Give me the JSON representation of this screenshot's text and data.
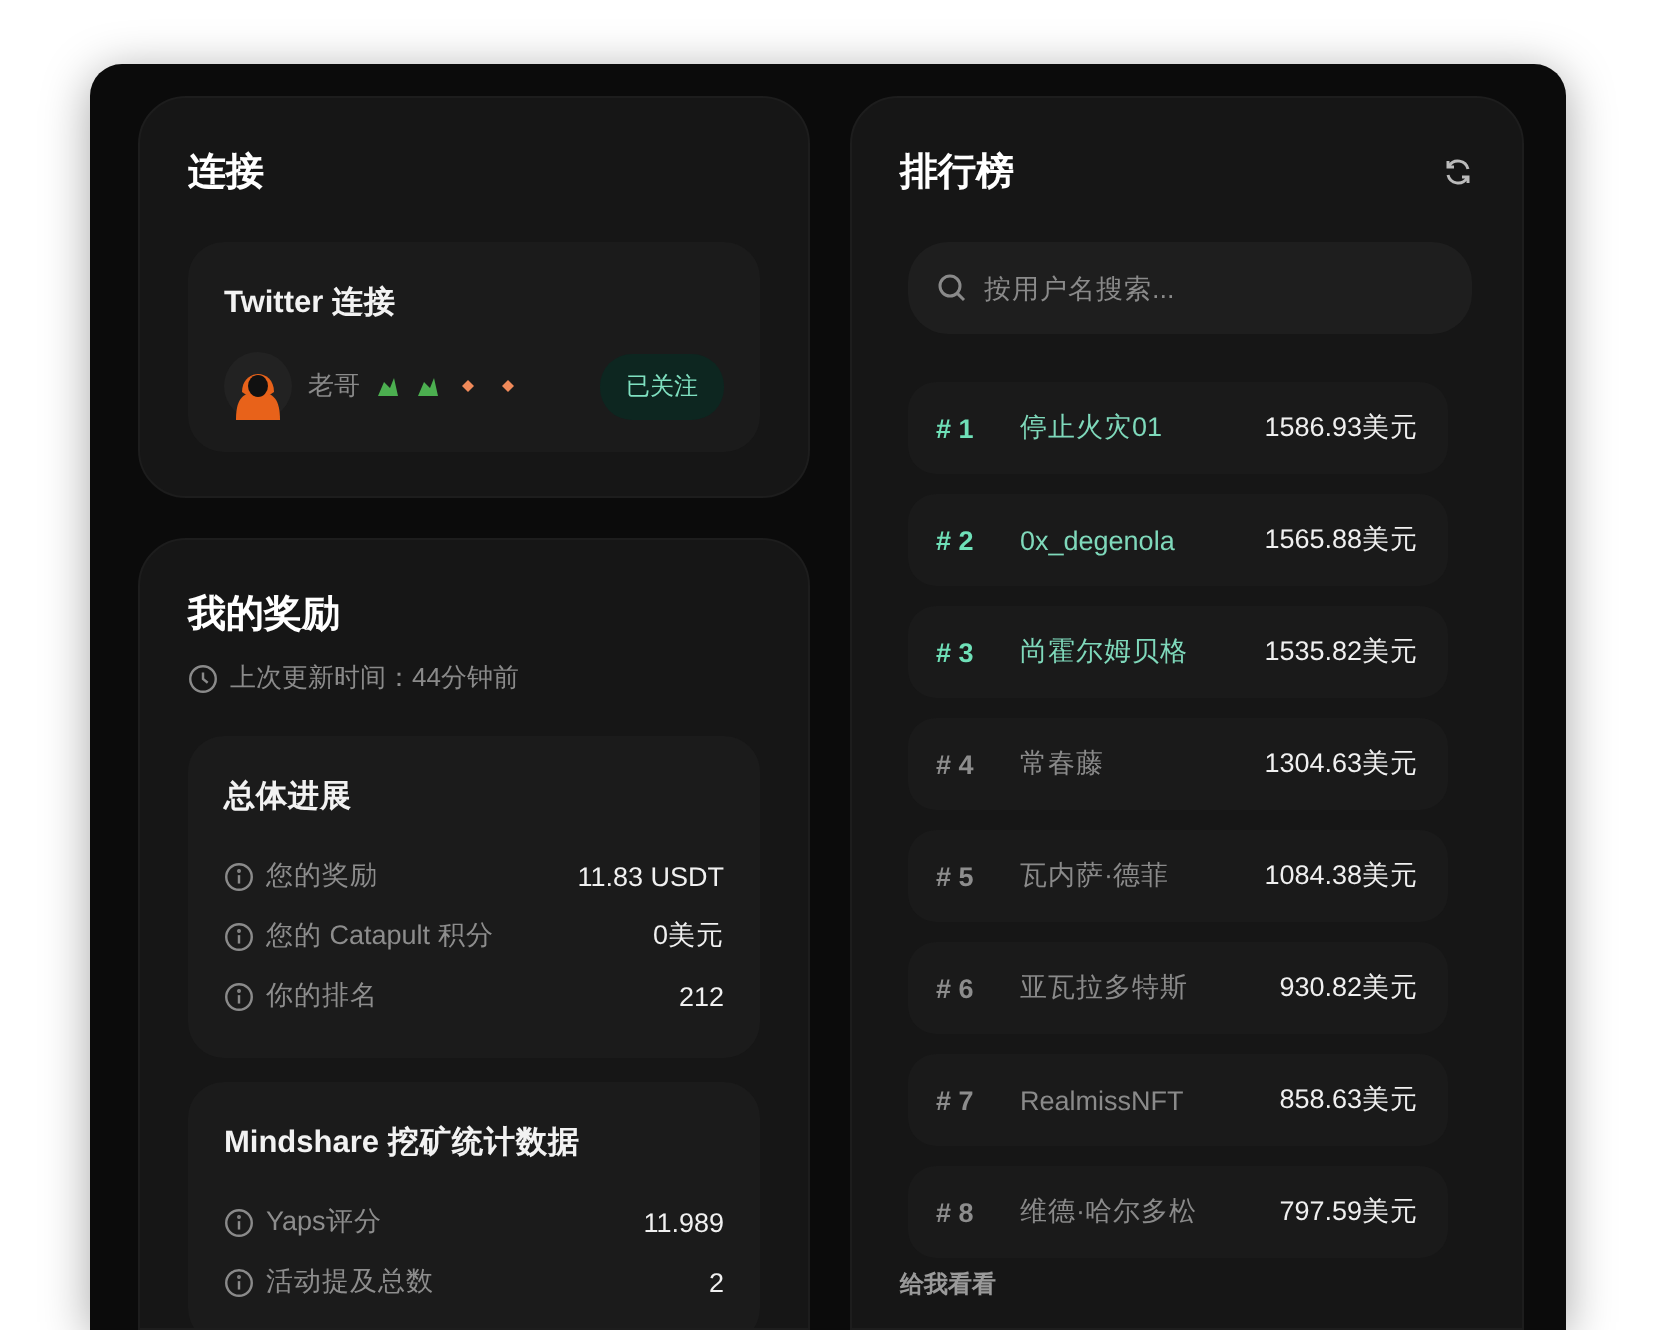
{
  "connect": {
    "title": "连接",
    "twitter": {
      "title": "Twitter 连接",
      "username": "老哥",
      "follow_button": "已关注"
    }
  },
  "rewards": {
    "title": "我的奖励",
    "updated": "上次更新时间：44分钟前",
    "sections": [
      {
        "title": "总体进展",
        "rows": [
          {
            "label": "您的奖励",
            "value": "11.83 USDT"
          },
          {
            "label": "您的 Catapult 积分",
            "value": "0美元"
          },
          {
            "label": "你的排名",
            "value": "212"
          }
        ]
      },
      {
        "title": "Mindshare 挖矿统计数据",
        "rows": [
          {
            "label": "Yaps评分",
            "value": "11.989"
          },
          {
            "label": "活动提及总数",
            "value": "2"
          }
        ]
      }
    ]
  },
  "leaderboard": {
    "title": "排行榜",
    "search": {
      "placeholder": "按用户名搜索..."
    },
    "rows": [
      {
        "rank": "# 1",
        "name": "停止火灾01",
        "amount": "1586.93美元",
        "highlighted": true
      },
      {
        "rank": "# 2",
        "name": "0x_degenola",
        "amount": "1565.88美元",
        "highlighted": true
      },
      {
        "rank": "# 3",
        "name": "尚霍尔姆贝格",
        "amount": "1535.82美元",
        "highlighted": true
      },
      {
        "rank": "# 4",
        "name": "常春藤",
        "amount": "1304.63美元",
        "highlighted": false
      },
      {
        "rank": "# 5",
        "name": "瓦内萨·德菲",
        "amount": "1084.38美元",
        "highlighted": false
      },
      {
        "rank": "# 6",
        "name": "亚瓦拉多特斯",
        "amount": "930.82美元",
        "highlighted": false
      },
      {
        "rank": "# 7",
        "name": "RealmissNFT",
        "amount": "858.63美元",
        "highlighted": false
      },
      {
        "rank": "# 8",
        "name": "维德·哈尔多松",
        "amount": "797.59美元",
        "highlighted": false
      }
    ],
    "footer_link": "给我看看"
  }
}
